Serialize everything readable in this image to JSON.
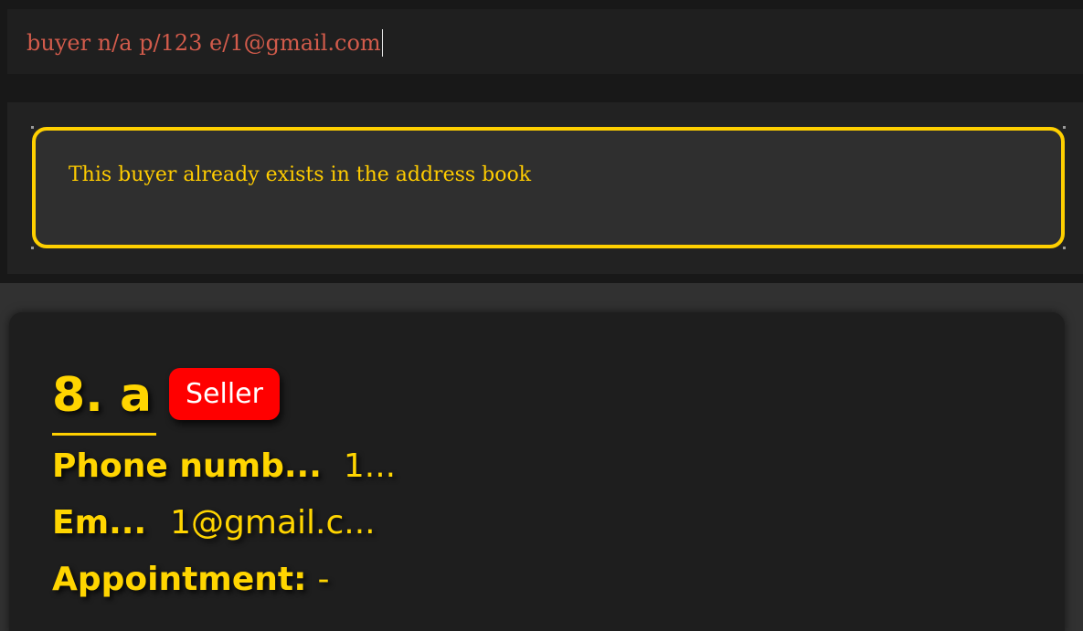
{
  "command_box": {
    "text": "buyer n/a p/123 e/1@gmail.com"
  },
  "result_display": {
    "message": "This buyer already exists in the address book"
  },
  "person_card": {
    "index_name": "8.  a",
    "role_badge": "Seller",
    "phone_label": "Phone numb...",
    "phone_value": "1...",
    "email_label": "Em...",
    "email_value": "1@gmail.c...",
    "appointment_label": "Appointment:",
    "appointment_value": "-"
  },
  "colors": {
    "accent": "#ffd000",
    "error_text": "#d25b4b",
    "badge_seller": "#ff0000",
    "background": "#181818"
  }
}
